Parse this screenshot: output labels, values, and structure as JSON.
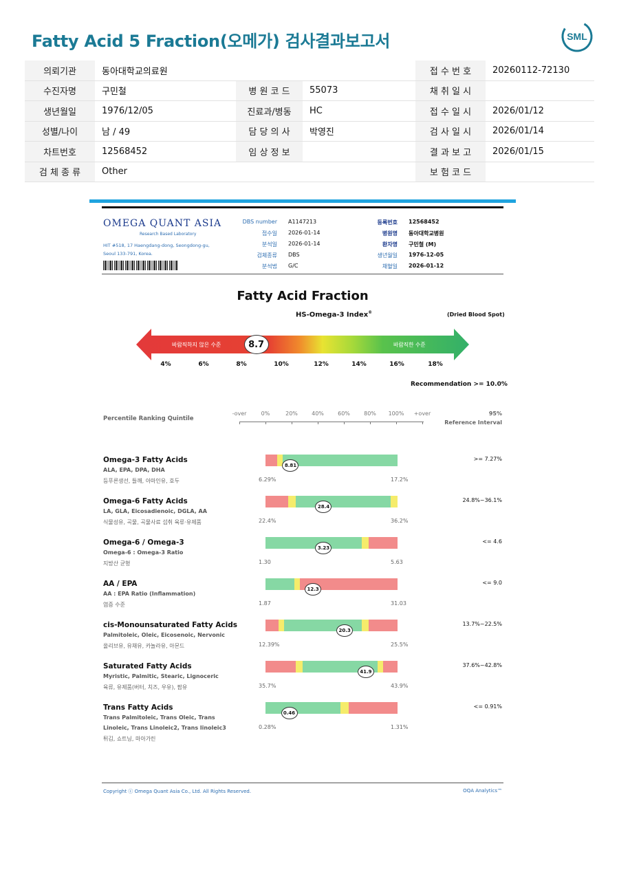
{
  "header": {
    "title": "Fatty Acid 5 Fraction(오메가) 검사결과보고서",
    "logo_text": "SML"
  },
  "info_rows": [
    {
      "l1": "의뢰기관",
      "v1": "동아대학교의료원",
      "l2": "",
      "v2": "",
      "l3": "접 수 번 호",
      "v3": "20260112-72130"
    },
    {
      "l1": "수진자명",
      "v1": "구민철",
      "l2": "병 원 코 드",
      "v2": "55073",
      "l3": "채 취 일 시",
      "v3": ""
    },
    {
      "l1": "생년월일",
      "v1": "1976/12/05",
      "l2": "진료과/병동",
      "v2": "HC",
      "l3": "접 수 일 시",
      "v3": "2026/01/12"
    },
    {
      "l1": "성별/나이",
      "v1": "남 / 49",
      "l2": "담 당 의 사",
      "v2": "박영진",
      "l3": "검 사 일 시",
      "v3": "2026/01/14"
    },
    {
      "l1": "차트번호",
      "v1": "12568452",
      "l2": "임 상 정 보",
      "v2": "",
      "l3": "결 과 보 고",
      "v3": "2026/01/15"
    },
    {
      "l1": "검 체 종 류",
      "v1": "Other",
      "l2": "",
      "v2": "",
      "l3": "보 험 코 드",
      "v3": ""
    }
  ],
  "lab": {
    "name": "OMEGA QUANT ASIA",
    "tagline": "Research Based Laboratory",
    "address1": "HIT #518, 17 Haengdang-dong, Seongdong-gu,",
    "address2": "Seoul 133-791, Korea.",
    "fields_left": [
      {
        "label": "DBS number",
        "value": "A1147213"
      },
      {
        "label": "접수일",
        "value": "2026-01-14"
      },
      {
        "label": "분석일",
        "value": "2026-01-14"
      },
      {
        "label": "검체종류",
        "value": "DBS"
      },
      {
        "label": "분석법",
        "value": "G/C"
      }
    ],
    "fields_right": [
      {
        "label": "등록번호",
        "value": "12568452"
      },
      {
        "label": "병원명",
        "value": "동아대학교병원"
      },
      {
        "label": "환자명",
        "value": "구민철 (M)"
      },
      {
        "label": "생년월일",
        "value": "1976-12-05"
      },
      {
        "label": "채혈일",
        "value": "2026-01-12"
      }
    ]
  },
  "section_title": "Fatty Acid Fraction",
  "index": {
    "title": "HS-Omega-3 Index",
    "reg": "®",
    "sample": "(Dried Blood Spot)",
    "value": "8.7",
    "value_num": 8.7,
    "low_label": "바람직하지 않은 수준",
    "high_label": "바람직한 수준",
    "ticks": [
      "4%",
      "6%",
      "8%",
      "10%",
      "12%",
      "14%",
      "16%",
      "18%"
    ],
    "recommendation": "Recommendation  >= 10.0%"
  },
  "quintile": {
    "label": "Percentile Ranking Quintile",
    "scale": [
      "-over",
      "0%",
      "20%",
      "40%",
      "60%",
      "80%",
      "100%",
      "+over"
    ],
    "ref_top": "95%",
    "ref_bottom": "Reference Interval"
  },
  "chart_data": {
    "type": "table",
    "rows": [
      {
        "name": "Omega-3 Fatty Acids",
        "sub": "ALA, EPA, DPA, DHA",
        "sub2": "",
        "kr": "등푸른생선, 들깨, 아마인유, 호두",
        "value": "8.81",
        "pos": 0.19,
        "min": "6.29%",
        "max": "17.2%",
        "ref": ">= 7.27%",
        "segs": [
          [
            "#f28b8b",
            0.09
          ],
          [
            "#f5ec6b",
            0.04
          ],
          [
            "#86d8a4",
            0.87
          ]
        ]
      },
      {
        "name": "Omega-6 Fatty Acids",
        "sub": "LA, GLA, Eicosadienoic, DGLA, AA",
        "sub2": "",
        "kr": "식물성유, 곡물, 곡물사료 섭취 육류·유제품",
        "value": "28.4",
        "pos": 0.44,
        "min": "22.4%",
        "max": "36.2%",
        "ref": "24.8%~36.1%",
        "segs": [
          [
            "#f28b8b",
            0.17
          ],
          [
            "#f5ec6b",
            0.06
          ],
          [
            "#86d8a4",
            0.72
          ],
          [
            "#f5ec6b",
            0.05
          ]
        ]
      },
      {
        "name": "Omega-6 / Omega-3",
        "sub": "Omega-6 : Omega-3 Ratio",
        "sub2": "",
        "kr": "지방산 균형",
        "value": "3.23",
        "pos": 0.44,
        "min": "1.30",
        "max": "5.63",
        "ref": "<= 4.6",
        "segs": [
          [
            "#86d8a4",
            0.73
          ],
          [
            "#f5ec6b",
            0.05
          ],
          [
            "#f28b8b",
            0.22
          ]
        ]
      },
      {
        "name": "AA / EPA",
        "sub": "AA : EPA Ratio (Inflammation)",
        "sub2": "",
        "kr": "염증 수준",
        "value": "12.3",
        "pos": 0.36,
        "min": "1.87",
        "max": "31.03",
        "ref": "<= 9.0",
        "segs": [
          [
            "#86d8a4",
            0.22
          ],
          [
            "#f5ec6b",
            0.04
          ],
          [
            "#f28b8b",
            0.74
          ]
        ]
      },
      {
        "name": "cis-Monounsaturated Fatty Acids",
        "sub": "Palmitoleic, Oleic, Eicosenoic, Nervonic",
        "sub2": "",
        "kr": "올리브유, 유채유, 카놀라유, 아몬드",
        "value": "20.3",
        "pos": 0.6,
        "min": "12.39%",
        "max": "25.5%",
        "ref": "13.7%~22.5%",
        "segs": [
          [
            "#f28b8b",
            0.1
          ],
          [
            "#f5ec6b",
            0.04
          ],
          [
            "#86d8a4",
            0.59
          ],
          [
            "#f5ec6b",
            0.05
          ],
          [
            "#f28b8b",
            0.22
          ]
        ]
      },
      {
        "name": "Saturated Fatty Acids",
        "sub": "Myristic, Palmitic, Stearic, Lignoceric",
        "sub2": "",
        "kr": "육류, 유제품(버터, 치즈, 우유), 팜유",
        "value": "41.9",
        "pos": 0.76,
        "min": "35.7%",
        "max": "43.9%",
        "ref": "37.6%~42.8%",
        "segs": [
          [
            "#f28b8b",
            0.23
          ],
          [
            "#f5ec6b",
            0.05
          ],
          [
            "#86d8a4",
            0.57
          ],
          [
            "#f5ec6b",
            0.04
          ],
          [
            "#f28b8b",
            0.11
          ]
        ]
      },
      {
        "name": "Trans Fatty Acids",
        "sub": "Trans Palmitoleic, Trans Oleic, Trans",
        "sub2": "Linoleic, Trans Linoleic2, Trans linoleic3",
        "kr": "튀김, 쇼트닝, 마아가린",
        "value": "0.46",
        "pos": 0.18,
        "min": "0.28%",
        "max": "1.31%",
        "ref": "<= 0.91%",
        "segs": [
          [
            "#86d8a4",
            0.57
          ],
          [
            "#f5ec6b",
            0.06
          ],
          [
            "#f28b8b",
            0.37
          ]
        ]
      }
    ]
  },
  "footer": {
    "copyright": "Copyright ⓒ Omega Quant Asia Co., Ltd.  All Rights Reserved.",
    "brand": "OQA Analytics™"
  }
}
